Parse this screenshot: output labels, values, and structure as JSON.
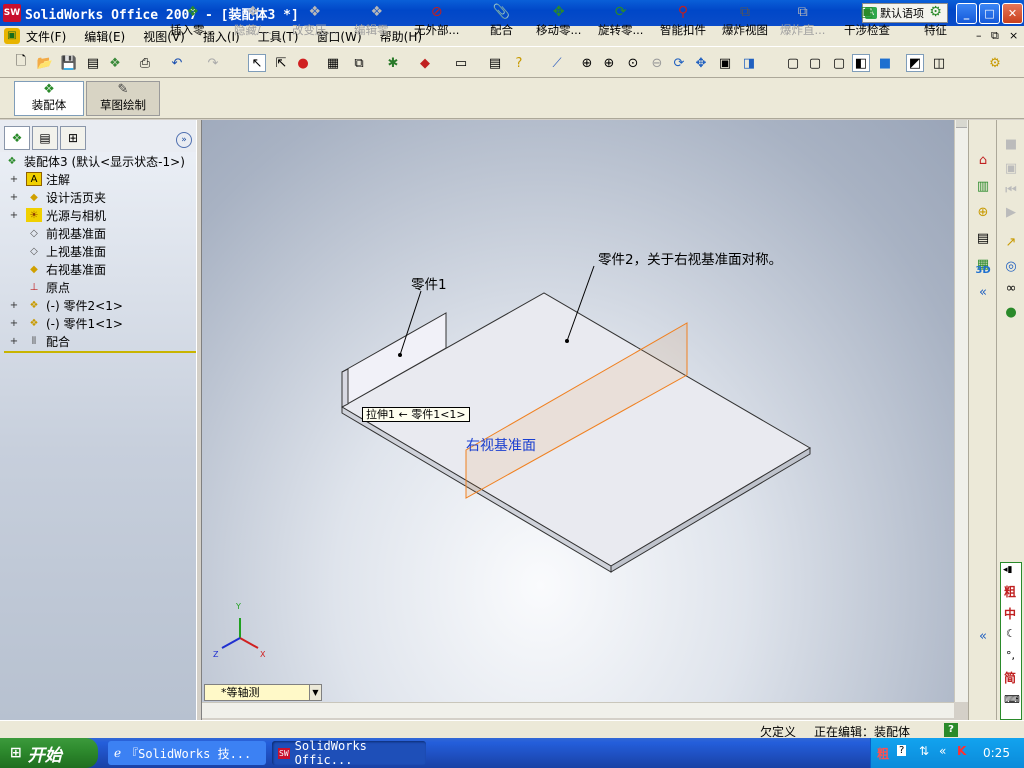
{
  "window": {
    "title": "SolidWorks Office 2007 - [装配体3 *]",
    "app_icon": "SW",
    "language_bar": "默认语项",
    "min_label": "_",
    "max_label": "□",
    "close_label": "✕"
  },
  "menu": {
    "items": [
      "文件(F)",
      "编辑(E)",
      "视图(V)",
      "插入(I)",
      "工具(T)",
      "窗口(W)",
      "帮助(H)"
    ],
    "mdi_controls": [
      "–",
      "⧉",
      "×"
    ]
  },
  "command_manager": {
    "assembly_label": "装配体",
    "sketch_label": "草图绘制",
    "commands": [
      {
        "label": "插入零...",
        "icon": "insert-component-icon",
        "enabled": true
      },
      {
        "label": "隐藏/...",
        "icon": "hide-show-icon",
        "enabled": false
      },
      {
        "label": "改变压...",
        "icon": "change-suppression-icon",
        "enabled": false
      },
      {
        "label": "编辑零...",
        "icon": "edit-component-icon",
        "enabled": false
      },
      {
        "label": "无外部...",
        "icon": "no-external-refs-icon",
        "enabled": true
      },
      {
        "label": "配合",
        "icon": "mate-icon",
        "enabled": true
      },
      {
        "label": "移动零...",
        "icon": "move-component-icon",
        "enabled": true
      },
      {
        "label": "旋转零...",
        "icon": "rotate-component-icon",
        "enabled": true
      },
      {
        "label": "智能扣件",
        "icon": "smart-fasteners-icon",
        "enabled": true
      },
      {
        "label": "爆炸视图",
        "icon": "exploded-view-icon",
        "enabled": true
      },
      {
        "label": "爆炸直...",
        "icon": "explode-line-icon",
        "enabled": false
      },
      {
        "label": "干涉检查",
        "icon": "interference-detection-icon",
        "enabled": true
      },
      {
        "label": "特征",
        "icon": "features-icon",
        "enabled": true
      }
    ]
  },
  "feature_tree": {
    "root": "装配体3  (默认<显示状态-1>)",
    "items": [
      {
        "label": "注解",
        "icon": "annotations-icon",
        "expandable": true
      },
      {
        "label": "设计活页夹",
        "icon": "design-binder-icon",
        "expandable": true
      },
      {
        "label": "光源与相机",
        "icon": "lights-cameras-icon",
        "expandable": true
      },
      {
        "label": "前视基准面",
        "icon": "plane-icon",
        "expandable": false
      },
      {
        "label": "上视基准面",
        "icon": "plane-icon",
        "expandable": false
      },
      {
        "label": "右视基准面",
        "icon": "plane-icon",
        "expandable": false
      },
      {
        "label": "原点",
        "icon": "origin-icon",
        "expandable": false
      },
      {
        "label": "(-) 零件2<1>",
        "icon": "part-icon",
        "expandable": true
      },
      {
        "label": "(-) 零件1<1>",
        "icon": "part-icon",
        "expandable": true
      },
      {
        "label": "配合",
        "icon": "mates-icon",
        "expandable": true
      }
    ]
  },
  "viewport": {
    "callout_part1": "零件1",
    "callout_part2": "零件2，关于右视基准面对称。",
    "tooltip_tag": "拉伸1 ← 零件1<1>",
    "plane_label": "右视基准面",
    "view_orientation": "*等轴测",
    "axis_x": "X",
    "axis_y": "Y",
    "axis_z": "Z"
  },
  "statusbar": {
    "state": "欠定义",
    "editing": "正在编辑：装配体",
    "help": "?"
  },
  "taskbar": {
    "start": "开始",
    "tasks": [
      "『SolidWorks 技...",
      "SolidWorks Offic..."
    ],
    "clock": "0:25"
  },
  "ime": {
    "chars": [
      "粗",
      "中",
      "简"
    ]
  }
}
